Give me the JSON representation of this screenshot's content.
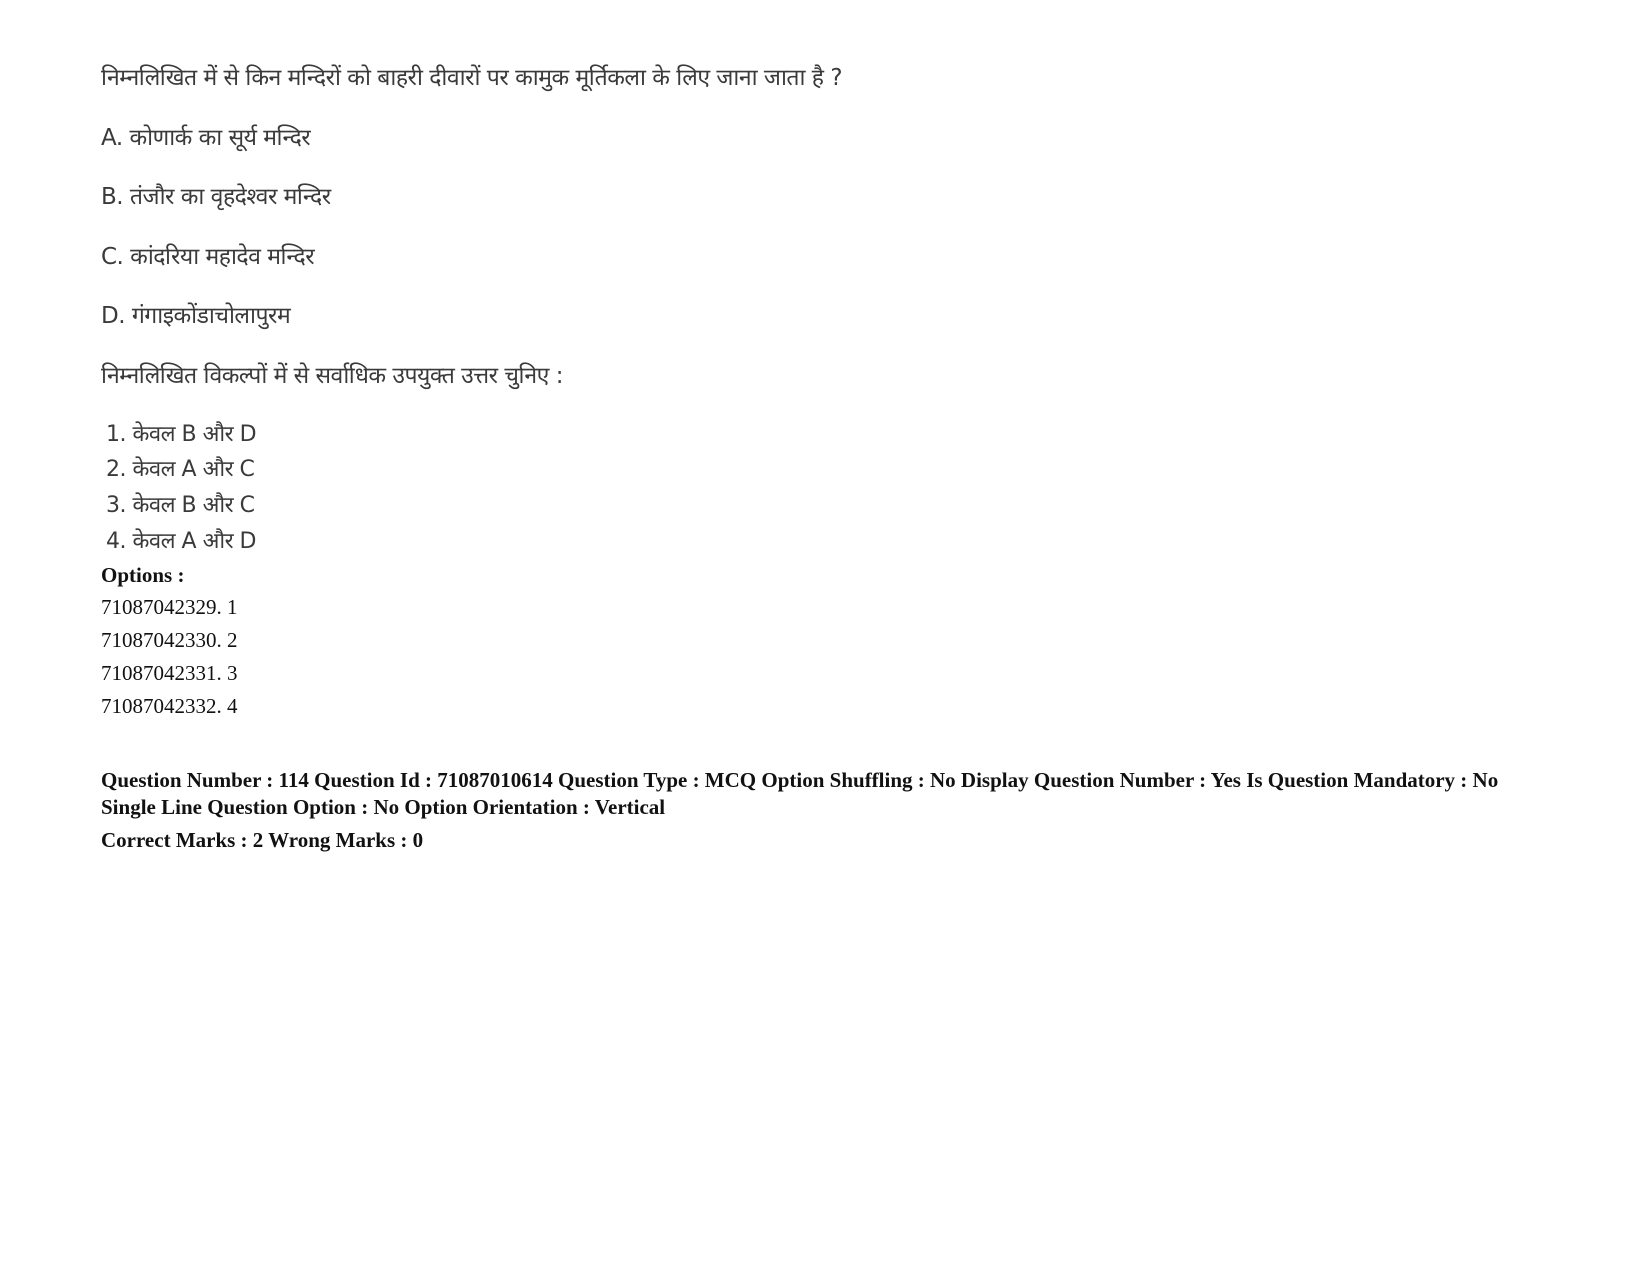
{
  "question": {
    "text": "निम्नलिखित में से किन मन्दिरों को बाहरी दीवारों पर कामुक मूर्तिकला के लिए जाना जाता है ?",
    "statements": [
      "A. कोणार्क का सूर्य मन्दिर",
      "B. तंजौर का वृहदेश्वर मन्दिर",
      "C. कांदरिया महादेव मन्दिर",
      "D. गंगाइकोंडाचोलापुरम"
    ],
    "instruction": "निम्नलिखित विकल्पों में से सर्वाधिक उपयुक्त उत्तर चुनिए :",
    "choices": [
      "1. केवल B और D",
      "2. केवल A और C",
      "3. केवल B और C",
      "4. केवल A और D"
    ]
  },
  "options": {
    "heading": "Options :",
    "items": [
      "71087042329. 1",
      "71087042330. 2",
      "71087042331. 3",
      "71087042332. 4"
    ]
  },
  "metadata": {
    "details": "Question Number : 114 Question Id : 71087010614 Question Type : MCQ Option Shuffling : No Display Question Number : Yes Is Question Mandatory : No Single Line Question Option : No Option Orientation : Vertical",
    "marks": "Correct Marks : 2 Wrong Marks : 0"
  }
}
